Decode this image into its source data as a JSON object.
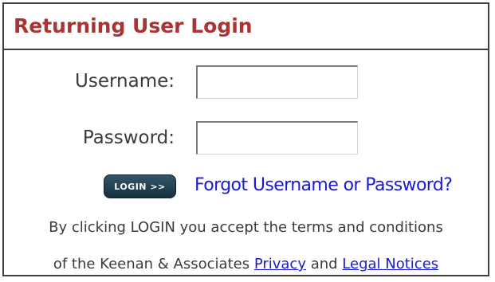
{
  "login_box": {
    "title": "Returning User Login",
    "username_label": "Username:",
    "username_value": "",
    "password_label": "Password:",
    "password_value": "",
    "login_button_label": "LOGIN >>",
    "forgot_link": "Forgot Username or Password?",
    "terms_line_1": "By clicking LOGIN you accept the terms and conditions",
    "terms_line_2_prefix": "of the Keenan & Associates ",
    "privacy_link": "Privacy",
    "terms_and": " and ",
    "legal_link": "Legal Notices"
  },
  "colors": {
    "title": "#a83434",
    "link": "#1a1ad0",
    "button": "#1f3b4d",
    "border": "#404040"
  }
}
